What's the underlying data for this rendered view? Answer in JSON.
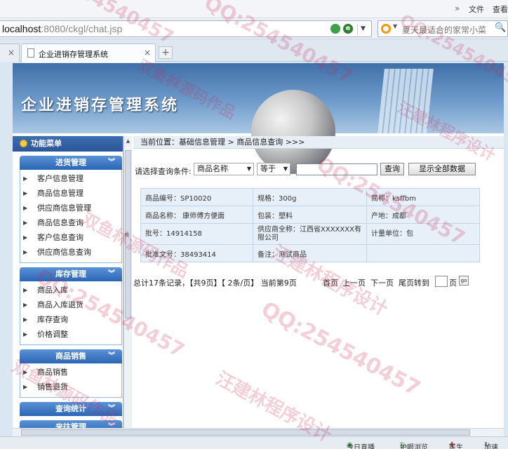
{
  "browser": {
    "menu": {
      "file": "文件",
      "view": "查看"
    },
    "address": {
      "host": "localhost",
      "rest": ":8080/ckgl/chat.jsp"
    },
    "search_placeholder": "夏天最适合的家常小菜",
    "tab_title": "企业进销存管理系统",
    "new_tab": "+",
    "status": {
      "live": "今日直播",
      "eye": "护眼浏览",
      "doctor": "医生",
      "accel": "加速"
    }
  },
  "banner": {
    "title": "企业进销存管理系统"
  },
  "sidebar": {
    "title": "功能菜单",
    "groups": [
      {
        "name": "进货管理",
        "items": [
          "客户信息管理",
          "商品信息管理",
          "供应商信息管理",
          "商品信息查询",
          "客户信息查询",
          "供应商信息查询"
        ]
      },
      {
        "name": "库存管理",
        "items": [
          "商品入库",
          "商品入库退货",
          "库存查询",
          "价格调整"
        ]
      },
      {
        "name": "商品销售",
        "items": [
          "商品销售",
          "销售退货"
        ]
      },
      {
        "name": "查询统计",
        "items": []
      },
      {
        "name": "来往管理",
        "items": []
      }
    ]
  },
  "main": {
    "breadcrumb": "当前位置：基础信息管理 > 商品信息查询 >>>",
    "query": {
      "label": "请选择查询条件:",
      "field": "商品名称",
      "op": "等于",
      "value": "",
      "search_btn": "查询",
      "show_all_btn": "显示全部数据"
    },
    "detail": {
      "r1": [
        "商品编号：SP10020",
        "规格：300g",
        "简称：ksffbm"
      ],
      "r2": [
        "商品名称： 康师傅方便面",
        "包装：塑料",
        "产地：成都"
      ],
      "r3": [
        "批号：14914158",
        "供应商全称：江西省XXXXXXX有限公司",
        "计量单位：包"
      ],
      "r4": [
        "批准文号：38493414",
        "备注：测试商品",
        ""
      ]
    },
    "pager": {
      "summary": "总计17条记录，【共9页】【 2条/页】 当前第9页",
      "first": "首页",
      "prev": "上一页",
      "next": "下一页",
      "last": "尾页转到",
      "page_unit": "页",
      "go": "go"
    }
  },
  "watermark": {
    "qq": "QQ:254540457",
    "author": "汪建林程序设计",
    "work": "双鱼林源码作品"
  }
}
